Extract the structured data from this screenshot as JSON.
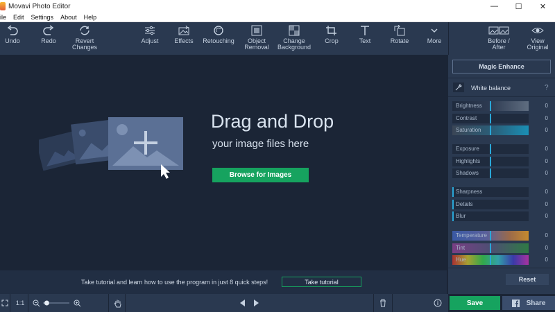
{
  "window": {
    "title": "Movavi Photo Editor",
    "minimize": "—",
    "maximize": "☐",
    "close": "✕"
  },
  "menu": [
    "ile",
    "Edit",
    "Settings",
    "About",
    "Help"
  ],
  "toolbar": {
    "undo": "Undo",
    "redo": "Redo",
    "revert": "Revert\nChanges",
    "adjust": "Adjust",
    "effects": "Effects",
    "retouching": "Retouching",
    "object_removal": "Object\nRemoval",
    "change_background": "Change\nBackground",
    "crop": "Crop",
    "text": "Text",
    "rotate": "Rotate",
    "more": "More",
    "before_after": "Before /\nAfter",
    "view_original": "View\nOriginal"
  },
  "canvas": {
    "title": "Drag and Drop",
    "subtitle": "your image files here",
    "browse": "Browse for Images",
    "tutorial_text": "Take tutorial and learn how to use the program in just 8 quick steps!",
    "tutorial_button": "Take tutorial"
  },
  "bottom": {
    "zoom_ratio": "1:1",
    "zoom_level": 0.1
  },
  "panel": {
    "magic": "Magic Enhance",
    "white_balance": "White balance",
    "help": "?",
    "groups": [
      [
        {
          "label": "Brightness",
          "value": "0",
          "style": "bright"
        },
        {
          "label": "Contrast",
          "value": "0",
          "style": "plain"
        },
        {
          "label": "Saturation",
          "value": "0",
          "style": "sat"
        }
      ],
      [
        {
          "label": "Exposure",
          "value": "0",
          "style": "plain"
        },
        {
          "label": "Highlights",
          "value": "0",
          "style": "plain"
        },
        {
          "label": "Shadows",
          "value": "0",
          "style": "plain"
        }
      ],
      [
        {
          "label": "Sharpness",
          "value": "0",
          "style": "left"
        },
        {
          "label": "Details",
          "value": "0",
          "style": "left"
        },
        {
          "label": "Blur",
          "value": "0",
          "style": "left"
        }
      ],
      [
        {
          "label": "Temperature",
          "value": "0",
          "style": "temp"
        },
        {
          "label": "Tint",
          "value": "0",
          "style": "tint"
        },
        {
          "label": "Hue",
          "value": "0",
          "style": "hue"
        }
      ]
    ],
    "reset": "Reset"
  },
  "actions": {
    "save": "Save",
    "share": "Share"
  },
  "colors": {
    "accent_green": "#16a35f",
    "panel_bg": "#2a3950",
    "canvas_bg": "#1b2536",
    "slider_handle": "#2aa7d8"
  }
}
